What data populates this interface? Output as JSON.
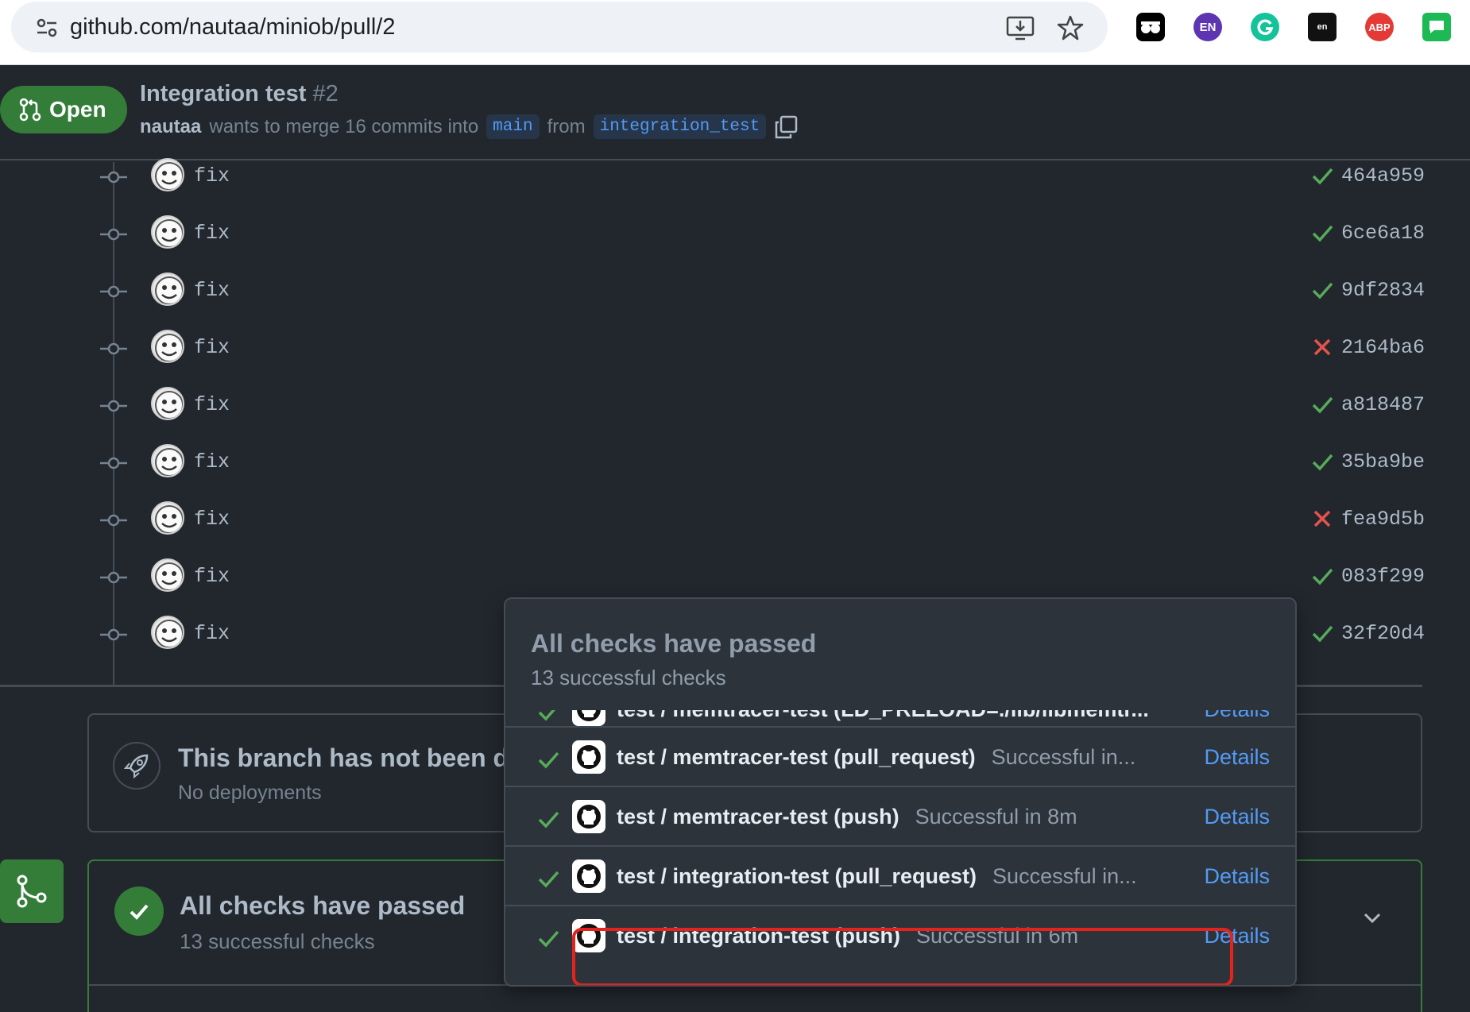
{
  "browser": {
    "url": "github.com/nautaa/miniob/pull/2",
    "extensions": [
      "glasses-extension",
      "EN",
      "grammarly",
      "en",
      "ABP",
      "chat-extension"
    ],
    "ext_labels": {
      "en_badge": "EN",
      "dict": "en",
      "abp": "ABP"
    }
  },
  "pr": {
    "status": "Open",
    "title": "Integration test",
    "number": "#2",
    "author": "nautaa",
    "merge_text": "wants to merge 16 commits into",
    "base_branch": "main",
    "from_text": "from",
    "head_branch": "integration_test"
  },
  "commits": [
    {
      "message": "fix",
      "sha": "464a959",
      "status": "success"
    },
    {
      "message": "fix",
      "sha": "6ce6a18",
      "status": "success"
    },
    {
      "message": "fix",
      "sha": "9df2834",
      "status": "success"
    },
    {
      "message": "fix",
      "sha": "2164ba6",
      "status": "failure"
    },
    {
      "message": "fix",
      "sha": "a818487",
      "status": "success"
    },
    {
      "message": "fix",
      "sha": "35ba9be",
      "status": "success"
    },
    {
      "message": "fix",
      "sha": "fea9d5b",
      "status": "failure"
    },
    {
      "message": "fix",
      "sha": "083f299",
      "status": "success"
    },
    {
      "message": "fix",
      "sha": "32f20d4",
      "status": "success"
    }
  ],
  "deployment": {
    "title": "This branch has not been deployed",
    "subtitle": "No deployments"
  },
  "checks": {
    "title": "All checks have passed",
    "subtitle": "13 successful checks"
  },
  "popover": {
    "title": "All checks have passed",
    "subtitle": "13 successful checks",
    "rows": [
      {
        "name": "test / memtracer-test (LD_PRELOAD=./lib/libmemtr...",
        "result": "",
        "details": "Details"
      },
      {
        "name": "test / memtracer-test (pull_request)",
        "result": "Successful in...",
        "details": "Details"
      },
      {
        "name": "test / memtracer-test (push)",
        "result": "Successful in 8m",
        "details": "Details"
      },
      {
        "name": "test / integration-test (pull_request)",
        "result": "Successful in...",
        "details": "Details"
      },
      {
        "name": "test / integration-test (push)",
        "result": "Successful in 6m",
        "details": "Details"
      }
    ]
  },
  "colors": {
    "success": "#57ab5a",
    "failure": "#e5534b",
    "link": "#539bf5",
    "open_badge": "#347d39",
    "highlight": "#e5221b"
  }
}
